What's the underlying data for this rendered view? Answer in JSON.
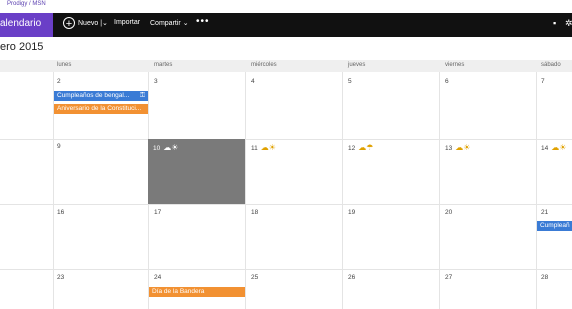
{
  "top_strip": {
    "text": "Prodigy / MSN"
  },
  "app": {
    "name": "alendario"
  },
  "commands": {
    "new_label": "Nuevo",
    "import_label": "Importar",
    "share_label": "Compartir",
    "more_label": "•••"
  },
  "view": {
    "month_title": "ero 2015"
  },
  "weekdays": [
    "lunes",
    "martes",
    "miércoles",
    "jueves",
    "viernes",
    "sábado"
  ],
  "weeks": [
    [
      "2",
      "3",
      "4",
      "5",
      "6",
      "7"
    ],
    [
      "9",
      "10",
      "11",
      "12",
      "13",
      "14"
    ],
    [
      "16",
      "17",
      "18",
      "19",
      "20",
      "21"
    ],
    [
      "23",
      "24",
      "25",
      "26",
      "27",
      "28"
    ]
  ],
  "events": {
    "e1": "Cumpleaños de bengal...",
    "e2": "Aniversario de la Constituci...",
    "e3": "Cumpleañ",
    "e4": "Día de la Bandera"
  },
  "icons": {
    "weather_10": "partly-cloudy-icon",
    "weather_11": "sun-cloud-icon",
    "weather_12": "cloud-rain-icon",
    "weather_13": "sun-cloud-icon",
    "weather_14": "sun-cloud-icon"
  },
  "colors": {
    "brand": "#6a3fc7",
    "event_blue": "#3a7bd5",
    "event_orange": "#f29132",
    "today": "#7a7a7a"
  }
}
